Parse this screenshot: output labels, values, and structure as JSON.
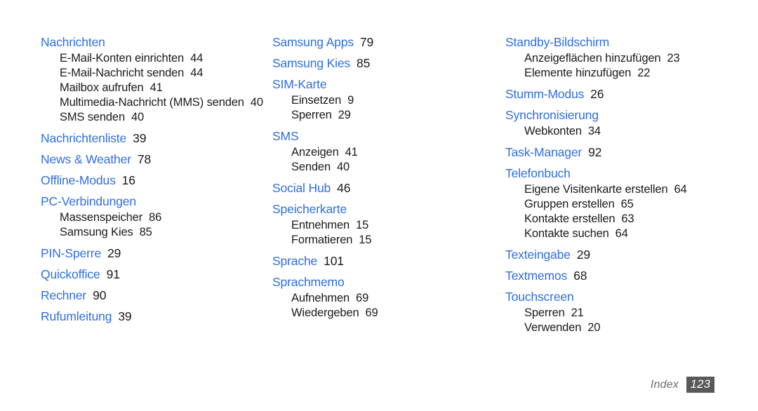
{
  "footer": {
    "label": "Index",
    "page_number": "123"
  },
  "colors": {
    "heading_blue": "#2f6ee0",
    "body_text": "#1a1a1a",
    "footer_label": "#6b6b6b",
    "badge_background": "#595959",
    "page_background": "#ffffff"
  },
  "columns": [
    {
      "entries": [
        {
          "heading": "Nachrichten",
          "page": "",
          "subentries": [
            {
              "label": "E-Mail-Konten einrichten",
              "page": "44"
            },
            {
              "label": "E-Mail-Nachricht senden",
              "page": "44"
            },
            {
              "label": "Mailbox aufrufen",
              "page": "41"
            },
            {
              "label": "Multimedia-Nachricht (MMS) senden",
              "page": "40"
            },
            {
              "label": "SMS senden",
              "page": "40"
            }
          ]
        },
        {
          "heading": "Nachrichtenliste",
          "page": "39",
          "subentries": []
        },
        {
          "heading": "News & Weather",
          "page": "78",
          "subentries": []
        },
        {
          "heading": "Offline-Modus",
          "page": "16",
          "subentries": []
        },
        {
          "heading": "PC-Verbindungen",
          "page": "",
          "subentries": [
            {
              "label": "Massenspeicher",
              "page": "86"
            },
            {
              "label": "Samsung Kies",
              "page": "85"
            }
          ]
        },
        {
          "heading": "PIN-Sperre",
          "page": "29",
          "subentries": []
        },
        {
          "heading": "Quickoffice",
          "page": "91",
          "subentries": []
        },
        {
          "heading": "Rechner",
          "page": "90",
          "subentries": []
        },
        {
          "heading": "Rufumleitung",
          "page": "39",
          "subentries": []
        }
      ]
    },
    {
      "entries": [
        {
          "heading": "Samsung Apps",
          "page": "79",
          "subentries": []
        },
        {
          "heading": "Samsung Kies",
          "page": "85",
          "subentries": []
        },
        {
          "heading": "SIM-Karte",
          "page": "",
          "subentries": [
            {
              "label": "Einsetzen",
              "page": "9"
            },
            {
              "label": "Sperren",
              "page": "29"
            }
          ]
        },
        {
          "heading": "SMS",
          "page": "",
          "subentries": [
            {
              "label": "Anzeigen",
              "page": "41"
            },
            {
              "label": "Senden",
              "page": "40"
            }
          ]
        },
        {
          "heading": "Social Hub",
          "page": "46",
          "subentries": []
        },
        {
          "heading": "Speicherkarte",
          "page": "",
          "subentries": [
            {
              "label": "Entnehmen",
              "page": "15"
            },
            {
              "label": "Formatieren",
              "page": "15"
            }
          ]
        },
        {
          "heading": "Sprache",
          "page": "101",
          "subentries": []
        },
        {
          "heading": "Sprachmemo",
          "page": "",
          "subentries": [
            {
              "label": "Aufnehmen",
              "page": "69"
            },
            {
              "label": "Wiedergeben",
              "page": "69"
            }
          ]
        }
      ]
    },
    {
      "entries": [
        {
          "heading": "Standby-Bildschirm",
          "page": "",
          "subentries": [
            {
              "label": "Anzeigeflächen hinzufügen",
              "page": "23"
            },
            {
              "label": "Elemente hinzufügen",
              "page": "22"
            }
          ]
        },
        {
          "heading": "Stumm-Modus",
          "page": "26",
          "subentries": []
        },
        {
          "heading": "Synchronisierung",
          "page": "",
          "subentries": [
            {
              "label": "Webkonten",
              "page": "34"
            }
          ]
        },
        {
          "heading": "Task-Manager",
          "page": "92",
          "subentries": []
        },
        {
          "heading": "Telefonbuch",
          "page": "",
          "subentries": [
            {
              "label": "Eigene Visitenkarte erstellen",
              "page": "64"
            },
            {
              "label": "Gruppen erstellen",
              "page": "65"
            },
            {
              "label": "Kontakte erstellen",
              "page": "63"
            },
            {
              "label": "Kontakte suchen",
              "page": "64"
            }
          ]
        },
        {
          "heading": "Texteingabe",
          "page": "29",
          "subentries": []
        },
        {
          "heading": "Textmemos",
          "page": "68",
          "subentries": []
        },
        {
          "heading": "Touchscreen",
          "page": "",
          "subentries": [
            {
              "label": "Sperren",
              "page": "21"
            },
            {
              "label": "Verwenden",
              "page": "20"
            }
          ]
        }
      ]
    }
  ]
}
